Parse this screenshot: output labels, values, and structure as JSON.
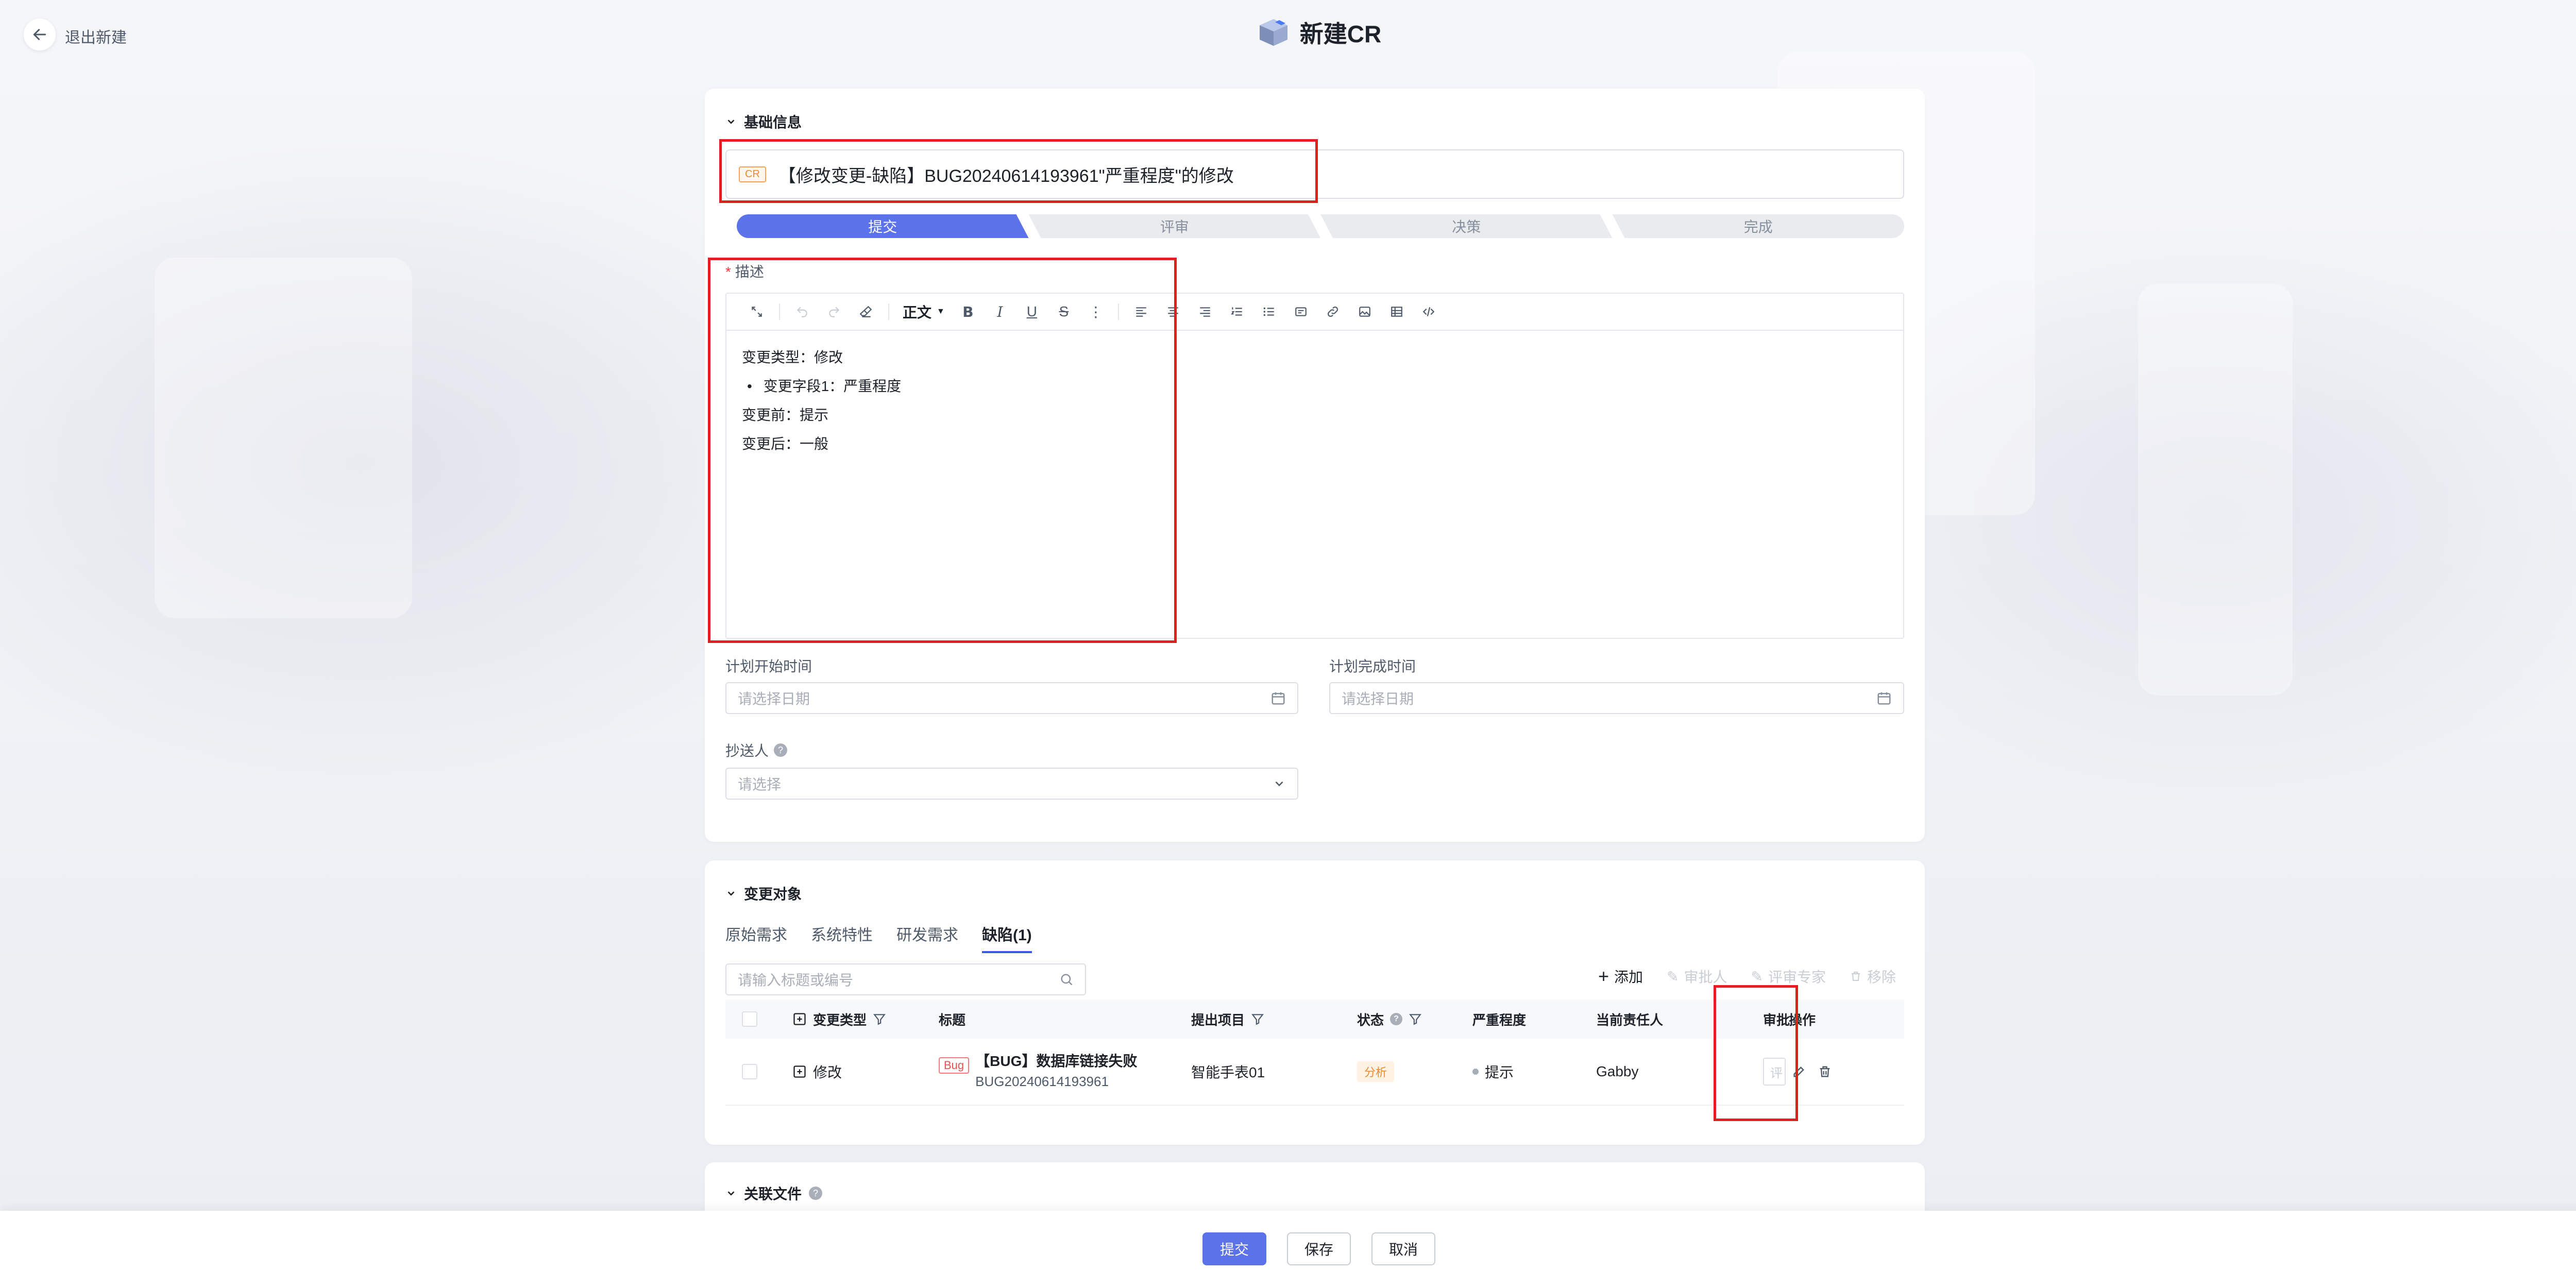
{
  "header": {
    "back_label": "退出新建",
    "page_title": "新建CR"
  },
  "basic": {
    "section_title": "基础信息",
    "cr_tag": "CR",
    "cr_title": "【修改变更-缺陷】BUG20240614193961\"严重程度\"的修改",
    "steps": [
      "提交",
      "评审",
      "决策",
      "完成"
    ],
    "description_label": "描述",
    "editor": {
      "format_label": "正文",
      "lines": [
        "变更类型：修改",
        "变更字段1：严重程度",
        "变更前：提示",
        "变更后：一般"
      ]
    },
    "plan_start_label": "计划开始时间",
    "plan_start_placeholder": "请选择日期",
    "plan_end_label": "计划完成时间",
    "plan_end_placeholder": "请选择日期",
    "cc_label": "抄送人",
    "cc_placeholder": "请选择"
  },
  "change_objects": {
    "section_title": "变更对象",
    "tabs": [
      "原始需求",
      "系统特性",
      "研发需求",
      "缺陷(1)"
    ],
    "search_placeholder": "请输入标题或编号",
    "actions": [
      "添加",
      "审批人",
      "评审专家",
      "移除"
    ],
    "columns": [
      "变更类型",
      "标题",
      "提出项目",
      "状态",
      "严重程度",
      "当前责任人",
      "审批",
      "操作"
    ],
    "rows": [
      {
        "change_type": "修改",
        "tag": "Bug",
        "title": "【BUG】数据库链接失败",
        "code": "BUG20240614193961",
        "project": "智能手表01",
        "status": "分析",
        "severity": "提示",
        "owner": "Gabby",
        "review": "评"
      }
    ]
  },
  "files": {
    "section_title": "关联文件"
  },
  "footer": {
    "submit": "提交",
    "save": "保存",
    "cancel": "取消"
  }
}
